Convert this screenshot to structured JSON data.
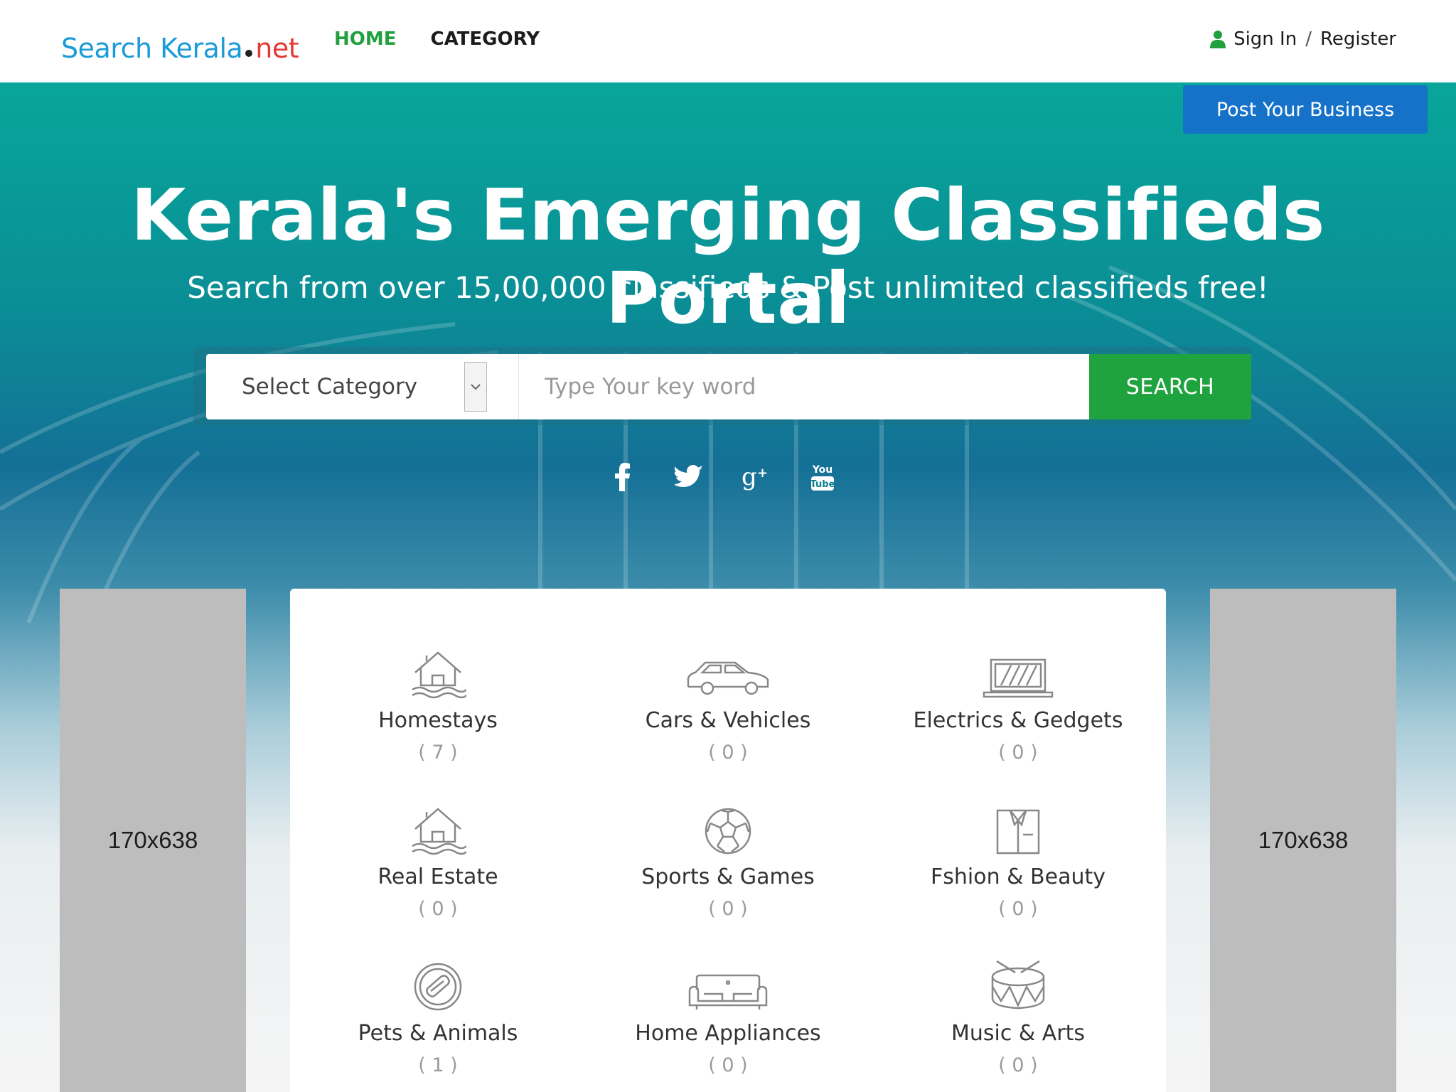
{
  "header": {
    "logo": {
      "part1": "Search Kerala",
      "part2": "net"
    },
    "nav": {
      "home": "HOME",
      "category": "CATEGORY"
    },
    "auth": {
      "signin": "Sign In",
      "separator": "/",
      "register": "Register"
    }
  },
  "hero": {
    "post_button": "Post Your Business",
    "headline": "Kerala's Emerging Classifieds Portal",
    "subline": "Search from over 15,00,000 classifieds & Post unlimited classifieds free!",
    "search": {
      "category_select": "Select Category",
      "keyword_placeholder": "Type Your key word",
      "button": "SEARCH"
    },
    "socials": [
      "facebook-icon",
      "twitter-icon",
      "google-plus-icon",
      "youtube-icon"
    ]
  },
  "ads": {
    "left": "170x638",
    "right": "170x638"
  },
  "categories": [
    {
      "name": "Homestays",
      "count": "( 7 )",
      "icon": "house-water-icon"
    },
    {
      "name": "Cars & Vehicles",
      "count": "( 0 )",
      "icon": "car-icon"
    },
    {
      "name": "Electrics & Gedgets",
      "count": "( 0 )",
      "icon": "laptop-icon"
    },
    {
      "name": "Real Estate",
      "count": "( 0 )",
      "icon": "house-water-icon"
    },
    {
      "name": "Sports & Games",
      "count": "( 0 )",
      "icon": "soccer-ball-icon"
    },
    {
      "name": "Fshion & Beauty",
      "count": "( 0 )",
      "icon": "shirt-icon"
    },
    {
      "name": "Pets & Animals",
      "count": "( 1 )",
      "icon": "pet-food-icon"
    },
    {
      "name": "Home Appliances",
      "count": "( 0 )",
      "icon": "sofa-icon"
    },
    {
      "name": "Music & Arts",
      "count": "( 0 )",
      "icon": "drum-icon"
    }
  ],
  "colors": {
    "brand_blue": "#1b9bd7",
    "accent_green": "#21a03e",
    "search_green": "#1fa33e",
    "post_blue": "#1572c8",
    "hero_teal": "#08a69a"
  }
}
